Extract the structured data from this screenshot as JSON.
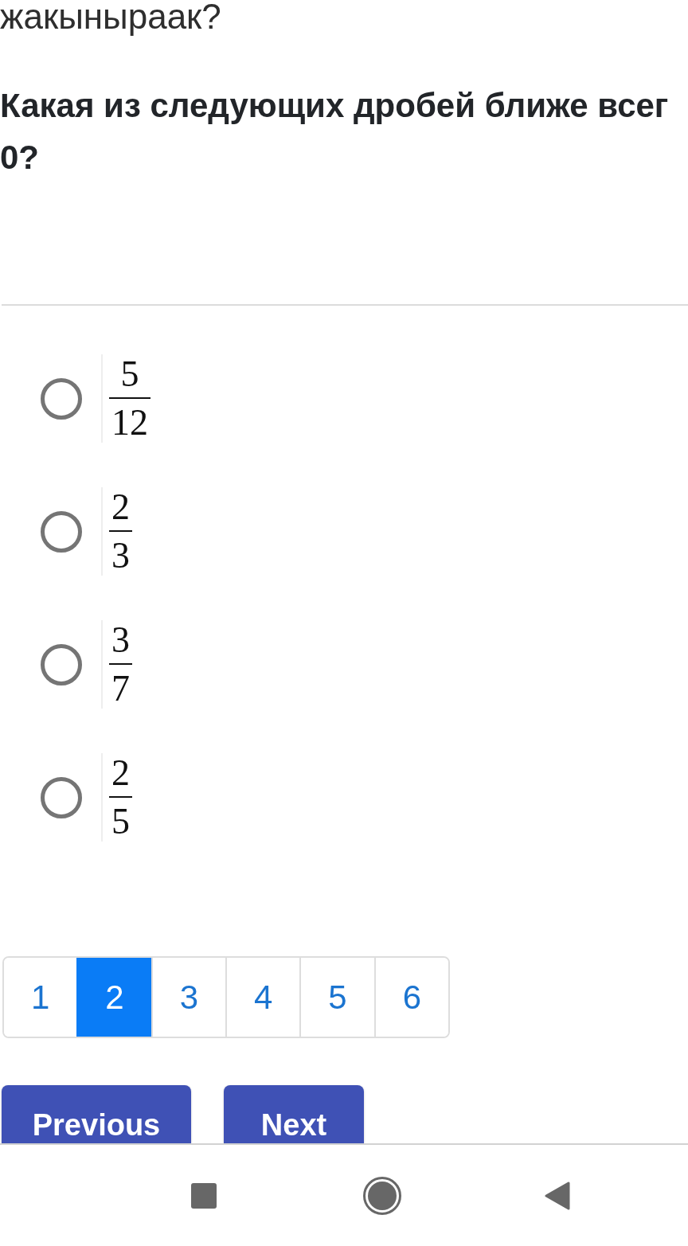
{
  "question_continued": "жакыныраак?",
  "question": "Какая из следующих дробей ближе всег\n0?",
  "options": [
    {
      "numerator": "5",
      "denominator": "12",
      "selected": false
    },
    {
      "numerator": "2",
      "denominator": "3",
      "selected": false
    },
    {
      "numerator": "3",
      "denominator": "7",
      "selected": false
    },
    {
      "numerator": "2",
      "denominator": "5",
      "selected": false
    }
  ],
  "pagination": [
    {
      "label": "1",
      "selected": false
    },
    {
      "label": "2",
      "selected": true
    },
    {
      "label": "3",
      "selected": false
    },
    {
      "label": "4",
      "selected": false
    },
    {
      "label": "5",
      "selected": false
    },
    {
      "label": "6",
      "selected": false
    }
  ],
  "buttons": [
    {
      "kind": "previous",
      "label": "Previous"
    },
    {
      "kind": "next",
      "label": "Next"
    }
  ]
}
